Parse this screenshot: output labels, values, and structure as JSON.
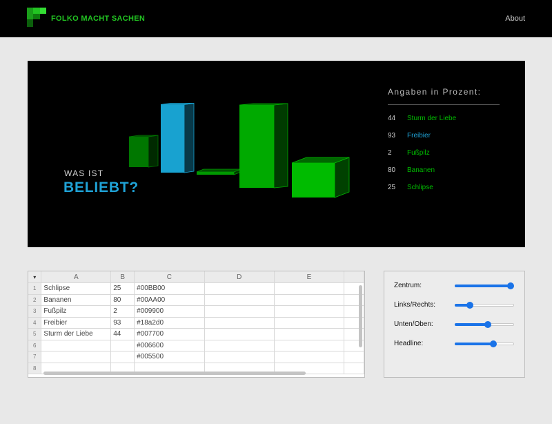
{
  "header": {
    "brand": "FOLKO MACHT SACHEN",
    "about_link": "About"
  },
  "hero": {
    "kicker": "WAS IST",
    "headline": "BELIEBT?",
    "legend_title": "Angaben in Prozent:",
    "legend": [
      {
        "value": "44",
        "label": "Sturm der Liebe",
        "color": "#00BB00"
      },
      {
        "value": "93",
        "label": "Freibier",
        "color": "#1fa2d6"
      },
      {
        "value": "2",
        "label": "Fußpilz",
        "color": "#00BB00"
      },
      {
        "value": "80",
        "label": "Bananen",
        "color": "#00BB00"
      },
      {
        "value": "25",
        "label": "Schlipse",
        "color": "#00BB00"
      }
    ]
  },
  "chart_data": {
    "type": "bar",
    "categories": [
      "Sturm der Liebe",
      "Freibier",
      "Fußpilz",
      "Bananen",
      "Schlipse"
    ],
    "values": [
      44,
      93,
      2,
      80,
      25
    ],
    "colors": [
      "#007700",
      "#18a2d0",
      "#009900",
      "#00AA00",
      "#00BB00"
    ],
    "ylabel": "",
    "ylim": [
      0,
      100
    ]
  },
  "spreadsheet": {
    "corner": "▾",
    "columns": [
      "A",
      "B",
      "C",
      "D",
      "E"
    ],
    "rows": [
      {
        "n": "1",
        "cells": [
          "Schlipse",
          "25",
          "#00BB00",
          "",
          ""
        ]
      },
      {
        "n": "2",
        "cells": [
          "Bananen",
          "80",
          "#00AA00",
          "",
          ""
        ]
      },
      {
        "n": "3",
        "cells": [
          "Fußpilz",
          "2",
          "#009900",
          "",
          ""
        ]
      },
      {
        "n": "4",
        "cells": [
          "Freibier",
          "93",
          "#18a2d0",
          "",
          ""
        ]
      },
      {
        "n": "5",
        "cells": [
          "Sturm der Liebe",
          "44",
          "#007700",
          "",
          ""
        ]
      },
      {
        "n": "6",
        "cells": [
          "",
          "",
          "#006600",
          "",
          ""
        ]
      },
      {
        "n": "7",
        "cells": [
          "",
          "",
          "#005500",
          "",
          ""
        ]
      },
      {
        "n": "8",
        "cells": [
          "",
          "",
          "",
          "",
          ""
        ]
      }
    ]
  },
  "controls": [
    {
      "label": "Zentrum:",
      "value": 1.0
    },
    {
      "label": "Links/Rechts:",
      "value": 0.22
    },
    {
      "label": "Unten/Oben:",
      "value": 0.56
    },
    {
      "label": "Headline:",
      "value": 0.67
    }
  ]
}
